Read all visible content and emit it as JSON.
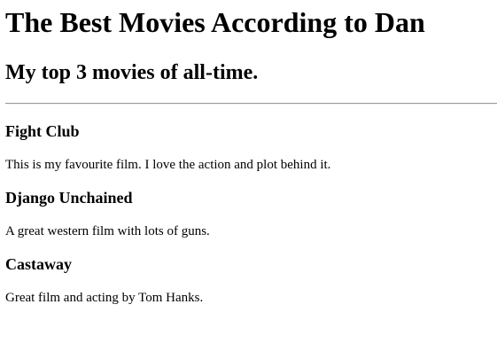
{
  "page": {
    "title": "The Best Movies According to Dan",
    "subtitle": "My top 3 movies of all-time."
  },
  "movies": [
    {
      "title": "Fight Club",
      "description": "This is my favourite film. I love the action and plot behind it."
    },
    {
      "title": "Django Unchained",
      "description": "A great western film with lots of guns."
    },
    {
      "title": "Castaway",
      "description": "Great film and acting by Tom Hanks."
    }
  ],
  "colors": {
    "text": "#000000",
    "background": "#ffffff",
    "rule": "#9a9a9a"
  }
}
